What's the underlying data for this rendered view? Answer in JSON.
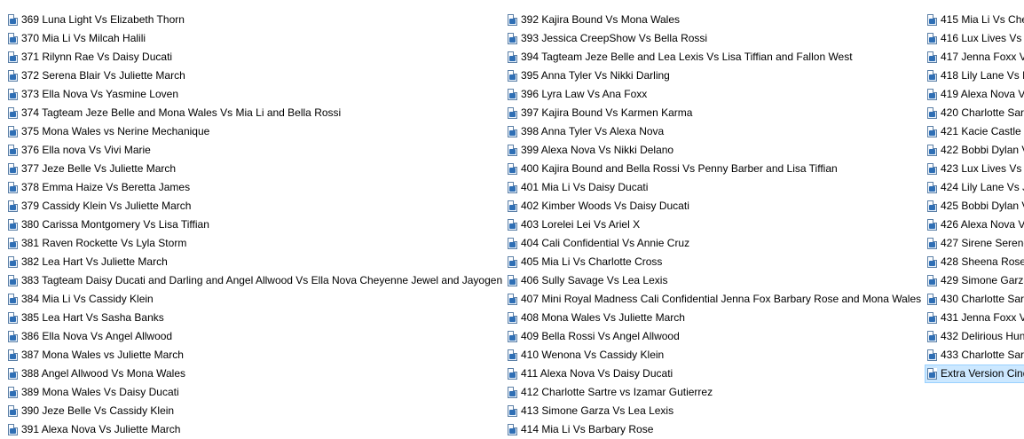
{
  "explorer": {
    "selection_color": "#cce8ff",
    "icon_name": "video-file-icon",
    "columns": [
      [
        "369 Luna Light Vs Elizabeth Thorn",
        "370 Mia Li Vs Milcah Halili",
        "371 Rilynn Rae Vs Daisy Ducati",
        "372 Serena Blair Vs Juliette March",
        "373 Ella Nova Vs Yasmine Loven",
        "374 Tagteam Jeze Belle and Mona Wales Vs Mia Li and Bella Rossi",
        "375 Mona Wales vs Nerine Mechanique",
        "376 Ella nova Vs Vivi Marie",
        "377 Jeze Belle Vs Juliette March",
        "378 Emma Haize Vs Beretta James",
        "379 Cassidy Klein Vs Juliette March",
        "380 Carissa Montgomery Vs Lisa Tiffian",
        "381 Raven Rockette Vs Lyla Storm",
        "382 Lea Hart Vs Juliette March",
        "383 Tagteam Daisy Ducati and Darling and Angel Allwood Vs Ella Nova Cheyenne Jewel and Jayogen",
        "384 Mia Li Vs Cassidy Klein",
        "385 Lea Hart Vs Sasha Banks",
        "386 Ella Nova Vs Angel Allwood",
        "387 Mona Wales vs Juliette March",
        "388 Angel Allwood Vs Mona Wales",
        "389 Mona Wales Vs Daisy Ducati",
        "390 Jeze Belle Vs Cassidy Klein",
        "391 Alexa Nova Vs Juliette March"
      ],
      [
        "392 Kajira Bound Vs Mona Wales",
        "393 Jessica CreepShow Vs Bella Rossi",
        "394 Tagteam Jeze Belle and Lea Lexis Vs Lisa Tiffian and Fallon West",
        "395 Anna Tyler Vs Nikki Darling",
        "396 Lyra Law Vs Ana Foxx",
        "397 Kajira Bound Vs Karmen Karma",
        "398 Anna Tyler Vs Alexa Nova",
        "399 Alexa Nova Vs Nikki Delano",
        "400 Kajira Bound and Bella Rossi Vs Penny Barber and Lisa Tiffian",
        "401 Mia Li Vs Daisy Ducati",
        "402 Kimber Woods Vs Daisy Ducati",
        "403 Lorelei Lei Vs Ariel X",
        "404 Cali Confidential Vs Annie Cruz",
        "405 Mia Li Vs Charlotte Cross",
        "406 Sully Savage Vs Lea Lexis",
        "407 Mini Royal Madness Cali Confidential Jenna Fox Barbary Rose and Mona Wales",
        "408 Mona Wales Vs Juliette March",
        "409 Bella Rossi Vs Angel Allwood",
        "410 Wenona Vs Cassidy Klein",
        "411 Alexa Nova Vs Daisy Ducati",
        "412 Charlotte Sartre vs Izamar Gutierrez",
        "413 Simone Garza Vs Lea Lexis",
        "414 Mia Li Vs Barbary Rose"
      ],
      [
        "415 Mia Li Vs Chey",
        "416 Lux Lives Vs A",
        "417 Jenna Foxx Vs",
        "418 Lily Lane Vs D",
        "419 Alexa Nova Vs",
        "420 Charlotte Sart",
        "421 Kacie Castle V",
        "422 Bobbi Dylan V",
        "423 Lux Lives Vs M",
        "424 Lily Lane Vs Jo",
        "425 Bobbi Dylan V",
        "426 Alexa Nova Vs",
        "427 Sirene Serene",
        "428 Sheena Rose V",
        "429 Simone Garza",
        "430 Charlotte Sart",
        "431 Jenna Foxx Vs",
        "432 Delirious Hun",
        "433 Charlotte Sart",
        "Extra Version Cind"
      ]
    ],
    "selected": {
      "column": 2,
      "index": 19
    }
  }
}
